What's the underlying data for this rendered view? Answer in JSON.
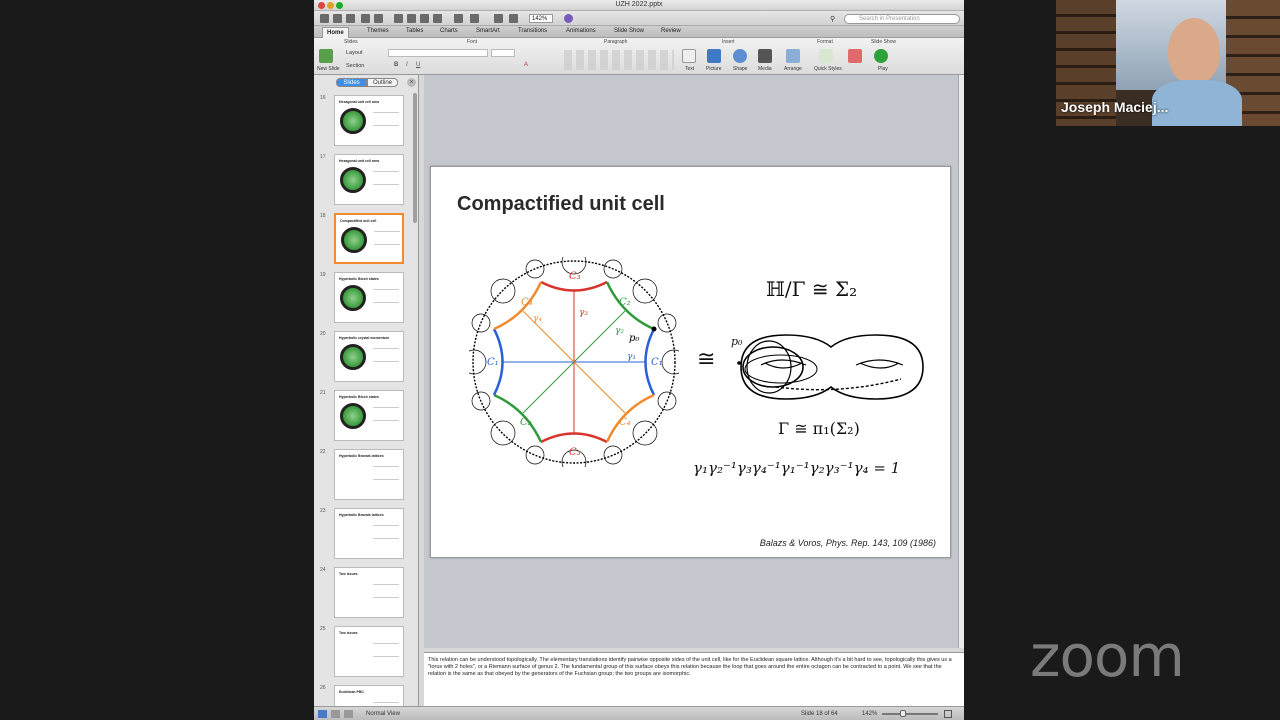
{
  "window": {
    "doc_title": "UZH 2022.pptx",
    "zoom": "142%",
    "search_placeholder": "Search in Presentation"
  },
  "ribbon_tabs": [
    "Home",
    "Themes",
    "Tables",
    "Charts",
    "SmartArt",
    "Transitions",
    "Animations",
    "Slide Show",
    "Review"
  ],
  "ribbon": {
    "groups": [
      "Slides",
      "Font",
      "Paragraph",
      "Insert",
      "Format",
      "Slide Show"
    ],
    "slides": {
      "new_slide": "New Slide",
      "layout": "Layout",
      "section": "Section"
    },
    "insert": [
      "Text",
      "Picture",
      "Shape",
      "Media",
      "Arrange"
    ],
    "format": [
      "Quick Styles"
    ],
    "slideshow": [
      "Play"
    ]
  },
  "panel": {
    "tab_slides": "Slides",
    "tab_outline": "Outline",
    "thumbnails": [
      {
        "num": "16",
        "title": "Hexagonal unit cell area"
      },
      {
        "num": "17",
        "title": "Hexagonal unit cell area"
      },
      {
        "num": "18",
        "title": "Compactified unit cell"
      },
      {
        "num": "19",
        "title": "Hyperbolic Bloch states"
      },
      {
        "num": "20",
        "title": "Hyperbolic crystal momentum"
      },
      {
        "num": "21",
        "title": "Hyperbolic Bloch states"
      },
      {
        "num": "22",
        "title": "Hyperbolic Bravais lattices"
      },
      {
        "num": "23",
        "title": "Hyperbolic Bravais lattices"
      },
      {
        "num": "24",
        "title": "Two issues"
      },
      {
        "num": "25",
        "title": "Two issues"
      },
      {
        "num": "26",
        "title": "Euclidean PBC"
      }
    ]
  },
  "slide": {
    "title": "Compactified unit cell",
    "eq_top": "ℍ/Γ ≅ Σ₂",
    "eq_cong": "≅",
    "eq_gamma": "Γ ≅ π₁(Σ₂)",
    "eq_relation": "γ₁γ₂⁻¹γ₃γ₄⁻¹γ₁⁻¹γ₂γ₃⁻¹γ₄ = 1",
    "p0_label": "p₀",
    "octagon_labels": {
      "C1": "C₁",
      "C2": "C₂",
      "C3": "C₃",
      "C4": "C₄",
      "g1": "γ₁",
      "g2": "γ₂",
      "g3": "γ₃",
      "g4": "γ₄",
      "p0": "p₀"
    },
    "citation": "Balazs & Voros, Phys. Rep. 143, 109 (1986)"
  },
  "notes": "This relation can be understood topologically. The elementary translations identify pairwise opposite sides of the unit cell, like for the Euclidean square lattice. Although it's a bit hard to see, topologically this gives us a \"torus with 2 holes\", or a Riemann surface of genus 2. The fundamental group of this surface obeys this relation because the loop that goes around the entire octagon can be contracted to a point. We see that the relation is the same as that obeyed by the generators of the Fuchsian group; the two groups are isomorphic.",
  "status": {
    "view": "Normal View",
    "slide_of": "Slide 18 of 64",
    "zoom": "142%"
  },
  "webcam": {
    "name": "Joseph Maciej..."
  },
  "zoom_logo": "zoom",
  "colors": {
    "c1": "#2a5fd6",
    "c2": "#2e9a3a",
    "c3": "#d8342c",
    "c4": "#f08a2c",
    "selected": "#f28a30"
  }
}
